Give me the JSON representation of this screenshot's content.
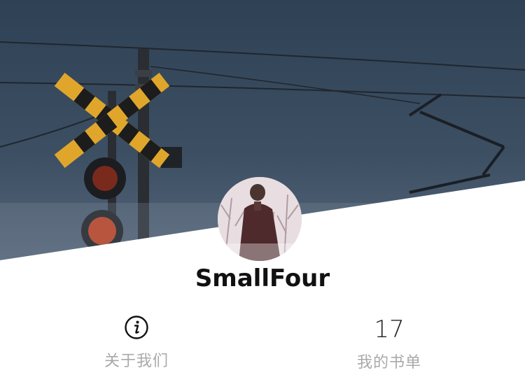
{
  "profile": {
    "username": "SmallFour"
  },
  "stats": {
    "about": {
      "icon": "info-icon",
      "label": "关于我们"
    },
    "booklist": {
      "count": "17",
      "label": "我的书单"
    }
  },
  "colors": {
    "sky": "#3a4b5d",
    "crossing_yellow": "#e0a62c",
    "signal_red": "#c8401e",
    "label_gray": "#a9a9a9",
    "username": "#111111"
  }
}
